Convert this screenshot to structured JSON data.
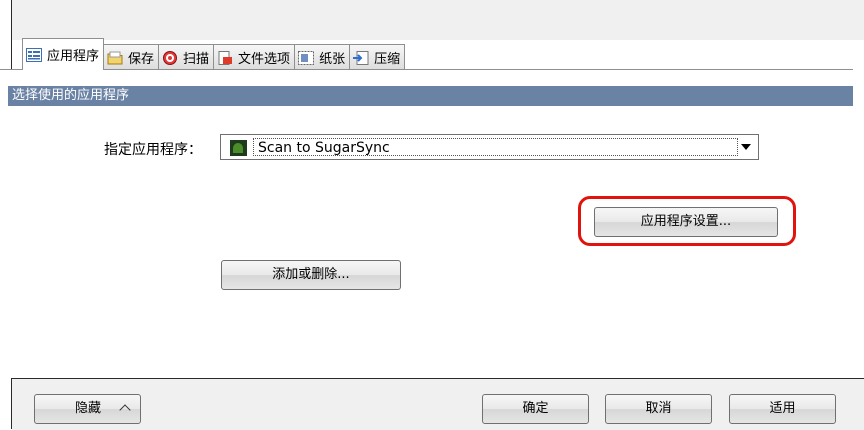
{
  "tabs": [
    {
      "label": "应用程序",
      "icon": "app-list-icon",
      "active": true
    },
    {
      "label": "保存",
      "icon": "folder-icon",
      "active": false
    },
    {
      "label": "扫描",
      "icon": "scan-icon",
      "active": false
    },
    {
      "label": "文件选项",
      "icon": "file-icon",
      "active": false
    },
    {
      "label": "纸张",
      "icon": "paper-icon",
      "active": false
    },
    {
      "label": "压缩",
      "icon": "compress-icon",
      "active": false
    }
  ],
  "section": {
    "title": "选择使用的应用程序"
  },
  "app_select": {
    "label": "指定应用程序：",
    "value": "Scan to SugarSync",
    "icon": "sugarsync-app-icon"
  },
  "buttons": {
    "app_settings": "应用程序设置...",
    "add_remove": "添加或删除...",
    "hide": "隐藏",
    "ok": "确定",
    "cancel": "取消",
    "apply": "适用"
  },
  "colors": {
    "section_bar": "#6a82a4",
    "highlight": "#e0140d"
  }
}
